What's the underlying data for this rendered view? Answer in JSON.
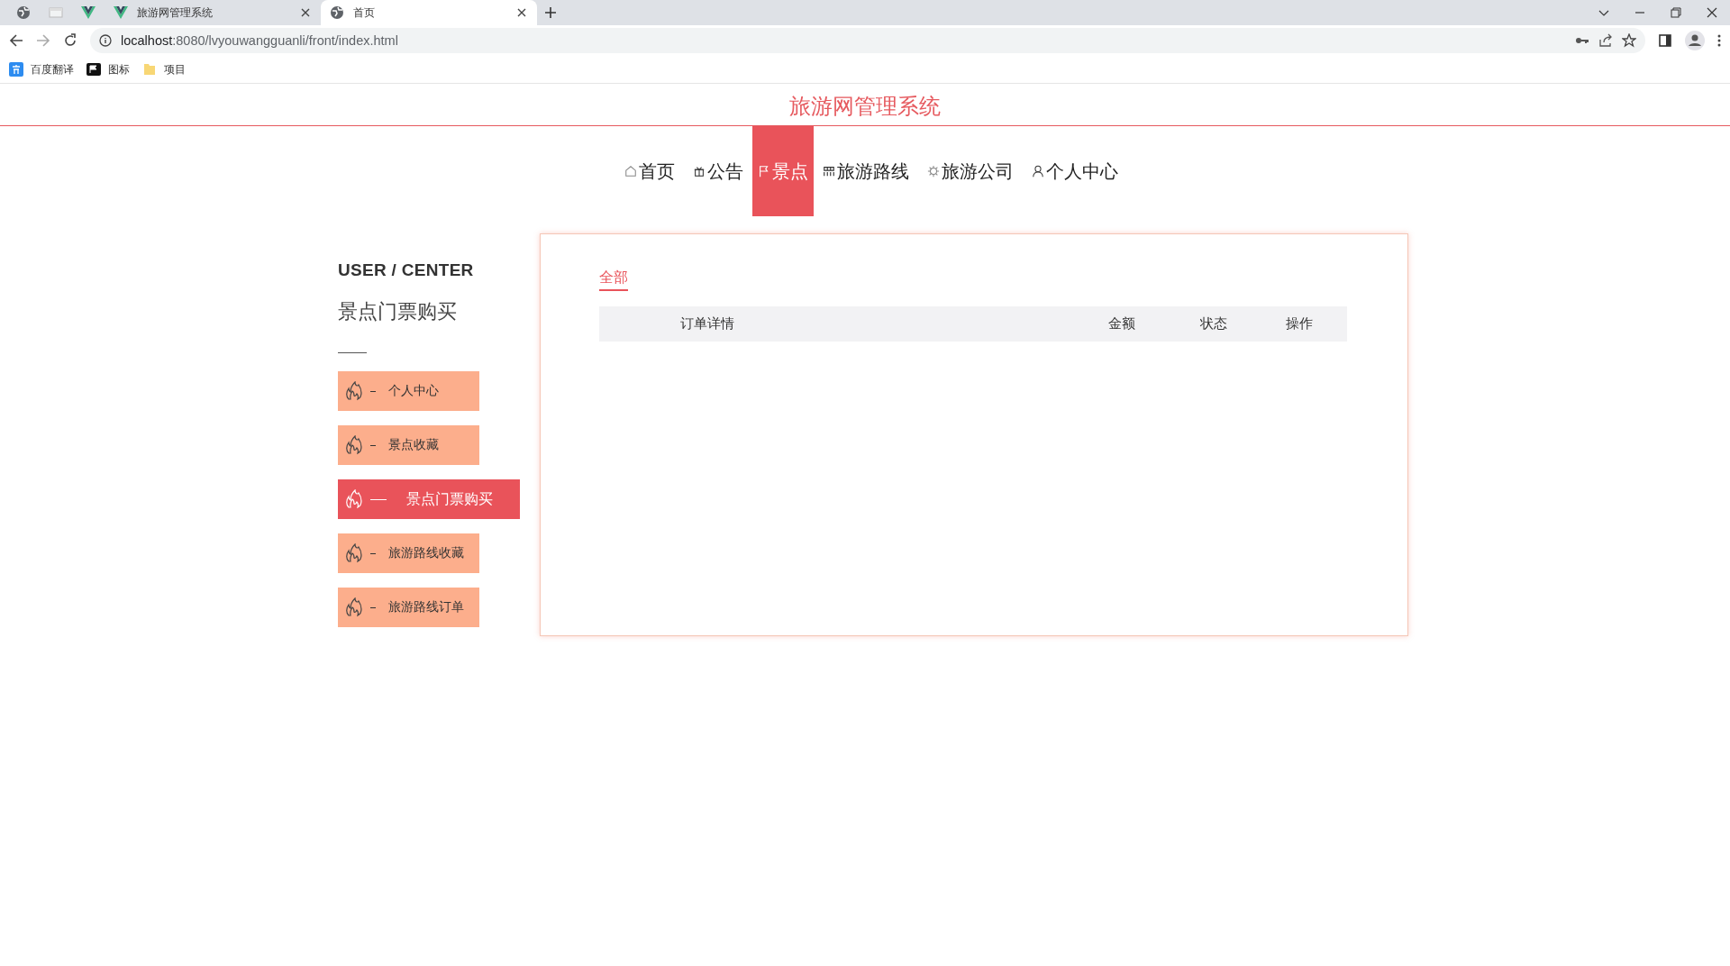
{
  "browser": {
    "tabs": [
      {
        "kind": "globe",
        "selected": false
      },
      {
        "kind": "page",
        "selected": false
      },
      {
        "kind": "vue",
        "selected": false
      },
      {
        "kind": "vue",
        "title": "旅游网管理系统",
        "selected": false
      },
      {
        "kind": "globe",
        "title": "首页",
        "selected": true
      }
    ],
    "url_host": "localhost",
    "url_rest": ":8080/lvyouwangguanli/front/index.html",
    "bookmarks": [
      {
        "kind": "translate",
        "label": "百度翻译"
      },
      {
        "kind": "flag",
        "label": "图标"
      },
      {
        "kind": "folder",
        "label": "项目"
      }
    ]
  },
  "site_title": "旅游网管理系统",
  "nav": [
    {
      "kind": "home",
      "label": "首页",
      "selected": false
    },
    {
      "kind": "gift",
      "label": "公告",
      "selected": false
    },
    {
      "kind": "flag",
      "label": "景点",
      "selected": true
    },
    {
      "kind": "grid",
      "label": "旅游路线",
      "selected": false
    },
    {
      "kind": "gear",
      "label": "旅游公司",
      "selected": false
    },
    {
      "kind": "user",
      "label": "个人中心",
      "selected": false
    }
  ],
  "sidebar": {
    "heading": "USER / CENTER",
    "subtitle": "景点门票购买",
    "items": [
      {
        "label": "个人中心",
        "selected": false
      },
      {
        "label": "景点收藏",
        "selected": false
      },
      {
        "label": "景点门票购买",
        "selected": true
      },
      {
        "label": "旅游路线收藏",
        "selected": false
      },
      {
        "label": "旅游路线订单",
        "selected": false
      }
    ]
  },
  "orders": {
    "filters": [
      {
        "label": "全部",
        "selected": true
      }
    ],
    "columns": [
      "订单详情",
      "金额",
      "状态",
      "操作"
    ]
  }
}
